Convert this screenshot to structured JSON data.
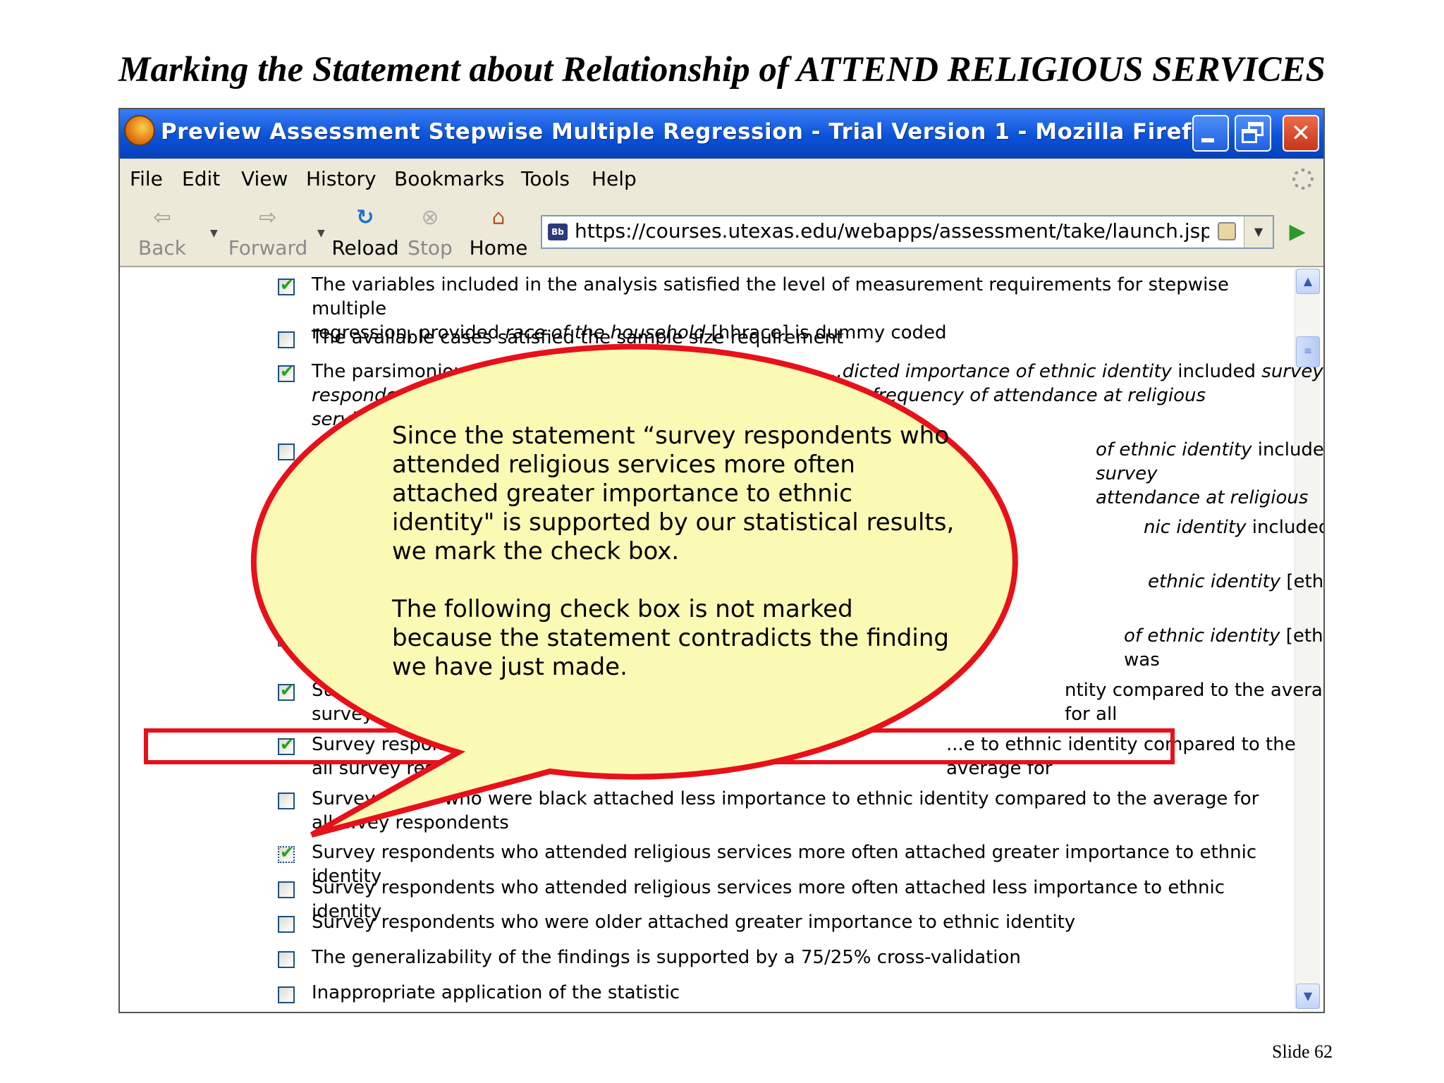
{
  "slide": {
    "title": "Marking the Statement about Relationship of ATTEND RELIGIOUS SERVICES",
    "number": "Slide 62"
  },
  "window": {
    "title": "Preview Assessment Stepwise Multiple Regression - Trial Version 1 - Mozilla Firefox",
    "controls": [
      "minimize-icon",
      "maximize-icon",
      "close-icon"
    ]
  },
  "menu": [
    "File",
    "Edit",
    "View",
    "History",
    "Bookmarks",
    "Tools",
    "Help"
  ],
  "nav": {
    "back": "Back",
    "forward": "Forward",
    "reload": "Reload",
    "stop": "Stop",
    "home": "Home",
    "url": "https://courses.utexas.edu/webapps/assessment/take/launch.jsp?cou",
    "site_icon": "Bb"
  },
  "items": [
    {
      "checked": true,
      "line1": "The variables included in the analysis satisfied the level of measurement requirements for stepwise multiple",
      "line2": "regression, provided race of the household [hhrace] is dummy coded"
    },
    {
      "checked": false,
      "line1": "The available cases satisfied the sample size requirement"
    },
    {
      "checked": true,
      "line1": "The parsimonious",
      "line1_right": "...dicted importance of ethnic identity included survey",
      "line2": "responden",
      "line2_right": "...nd frequency of attendance at religious",
      "line3": "servi"
    },
    {
      "checked": false,
      "line1_right": "of ethnic identity included survey",
      "line2_right": "attendance at religious"
    },
    {
      "checked": false,
      "line1_right": "nic identity included survey"
    },
    {
      "checked": false,
      "line1_right": "ethnic identity [ethimp] was"
    },
    {
      "checked": true,
      "line1_right": "of ethnic identity [ethimp] was"
    },
    {
      "checked": true,
      "line1": "Su",
      "line1_right": "ntity compared to the average for all",
      "line2": "survey"
    },
    {
      "checked": true,
      "line1": "Survey respon",
      "line1_right": "...e to ethnic identity compared to the average for",
      "line2": "all survey res"
    },
    {
      "checked": false,
      "line1": "Survey ...ents who were black attached less importance to ethnic identity compared to the average for",
      "line2": "all ...vey respondents"
    },
    {
      "checked": true,
      "line1": "Survey respondents who attended religious services more often attached greater importance to ethnic identity"
    },
    {
      "checked": false,
      "line1": "Survey respondents who attended religious services more often attached less importance to ethnic identity"
    },
    {
      "checked": false,
      "line1": "Survey respondents who were older attached greater importance to ethnic identity"
    },
    {
      "checked": false,
      "line1": "The generalizability of the findings is supported by a 75/25% cross-validation"
    },
    {
      "checked": false,
      "line1": "Inappropriate application of the statistic"
    }
  ],
  "callout": {
    "paragraph1": "Since the statement “survey respondents who attended religious services more often attached greater importance to ethnic identity\" is supported by our statistical results, we mark the check box.",
    "paragraph2": "The following check box is not marked because the statement contradicts the finding we have just made.",
    "fill": "#fafab4",
    "border": "#e8101a"
  }
}
